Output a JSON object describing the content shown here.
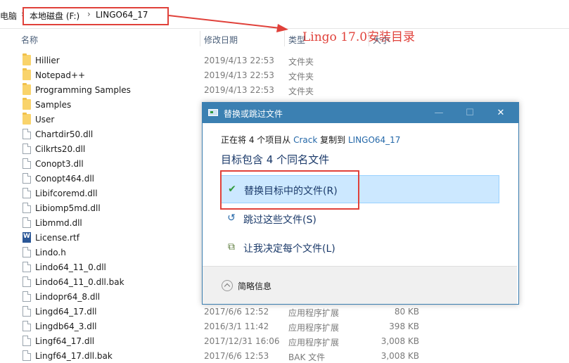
{
  "address": {
    "crumb_start": "电脑",
    "sep": "›",
    "drive": "本地磁盘 (F:)",
    "folder": "LINGO64_17"
  },
  "annotation": {
    "install_dir_text": "Lingo 17.0安装目录",
    "color": "#e0413a"
  },
  "columns": {
    "name": "名称",
    "date": "修改日期",
    "type": "类型",
    "size": "大小"
  },
  "files": [
    {
      "name": "Hillier",
      "kind": "folder",
      "date": "2019/4/13 22:53",
      "type": "文件夹",
      "size": ""
    },
    {
      "name": "Notepad++",
      "kind": "folder",
      "date": "2019/4/13 22:53",
      "type": "文件夹",
      "size": ""
    },
    {
      "name": "Programming Samples",
      "kind": "folder",
      "date": "2019/4/13 22:53",
      "type": "文件夹",
      "size": ""
    },
    {
      "name": "Samples",
      "kind": "folder",
      "date": "",
      "type": "",
      "size": ""
    },
    {
      "name": "User",
      "kind": "folder",
      "date": "",
      "type": "",
      "size": ""
    },
    {
      "name": "Chartdir50.dll",
      "kind": "file",
      "date": "",
      "type": "",
      "size": ""
    },
    {
      "name": "Cilkrts20.dll",
      "kind": "file",
      "date": "",
      "type": "",
      "size": ""
    },
    {
      "name": "Conopt3.dll",
      "kind": "file",
      "date": "",
      "type": "",
      "size": ""
    },
    {
      "name": "Conopt464.dll",
      "kind": "file",
      "date": "",
      "type": "",
      "size": ""
    },
    {
      "name": "Libifcoremd.dll",
      "kind": "file",
      "date": "",
      "type": "",
      "size": ""
    },
    {
      "name": "Libiomp5md.dll",
      "kind": "file",
      "date": "",
      "type": "",
      "size": ""
    },
    {
      "name": "Libmmd.dll",
      "kind": "file",
      "date": "",
      "type": "",
      "size": ""
    },
    {
      "name": "License.rtf",
      "kind": "word",
      "date": "",
      "type": "",
      "size": ""
    },
    {
      "name": "Lindo.h",
      "kind": "file",
      "date": "",
      "type": "",
      "size": ""
    },
    {
      "name": "Lindo64_11_0.dll",
      "kind": "file",
      "date": "",
      "type": "",
      "size": ""
    },
    {
      "name": "Lindo64_11_0.dll.bak",
      "kind": "file",
      "date": "",
      "type": "",
      "size": ""
    },
    {
      "name": "Lindopr64_8.dll",
      "kind": "file",
      "date": "",
      "type": "",
      "size": ""
    },
    {
      "name": "Lingd64_17.dll",
      "kind": "file",
      "date": "2017/6/6 12:52",
      "type": "应用程序扩展",
      "size": "80 KB"
    },
    {
      "name": "Lingdb64_3.dll",
      "kind": "file",
      "date": "2016/3/1 11:42",
      "type": "应用程序扩展",
      "size": "398 KB"
    },
    {
      "name": "Lingf64_17.dll",
      "kind": "file",
      "date": "2017/12/31 16:06",
      "type": "应用程序扩展",
      "size": "3,008 KB"
    },
    {
      "name": "Lingf64_17.dll.bak",
      "kind": "file",
      "date": "2017/6/6 12:53",
      "type": "BAK 文件",
      "size": "3,008 KB"
    }
  ],
  "dialog": {
    "title": "替换或跳过文件",
    "btn_minimize": "—",
    "btn_maximize": "☐",
    "btn_close": "✕",
    "line1_prefix": "正在将 4 个项目从 ",
    "line1_source": "Crack",
    "line1_mid": " 复制到 ",
    "line1_dest": "LINGO64_17",
    "heading": "目标包含 4 个同名文件",
    "options": [
      {
        "label": "替换目标中的文件(R)",
        "icon": "checkmark-icon",
        "glyph": "✔",
        "color": "#2e9a3a"
      },
      {
        "label": "跳过这些文件(S)",
        "icon": "skip-arrow-icon",
        "glyph": "↺",
        "color": "#2367a8"
      },
      {
        "label": "让我决定每个文件(L)",
        "icon": "decide-files-icon",
        "glyph": "⧉",
        "color": "#5a7a3a"
      }
    ],
    "more_info": "简略信息"
  }
}
